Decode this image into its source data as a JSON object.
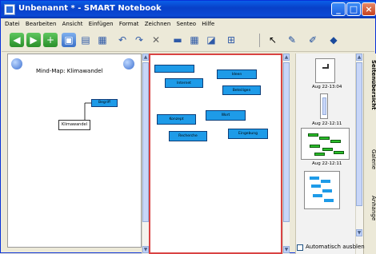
{
  "window": {
    "title": "Unbenannt * - SMART Notebook"
  },
  "menu": [
    "Datei",
    "Bearbeiten",
    "Ansicht",
    "Einfügen",
    "Format",
    "Zeichnen",
    "Senteo",
    "Hilfe"
  ],
  "left_panel": {
    "title": "Mind-Map: Klimawandel",
    "node_blue": "Begriff",
    "node_white": "Klimawandel"
  },
  "canvas_boxes": [
    "Internet",
    "Ideen",
    "Beteiligen",
    "Konzept",
    "Wort",
    "Recherche",
    "Eingebung"
  ],
  "sidebar": {
    "thumb1_label": "Aug 22-13:04",
    "thumb2_label": "Aug 22-12:11",
    "thumb3_label": "Aug 22-12:11",
    "autohide_label": "Automatisch ausblen"
  },
  "tabs": [
    "Seitenübersicht",
    "Galerie",
    "Anhänge"
  ],
  "colors": {
    "title_bar": "#0A5FE8",
    "node_blue": "#1E9BE8",
    "canvas_border": "#D94343"
  },
  "icons": [
    "window-app-icon",
    "minimize-icon",
    "maximize-icon",
    "close-icon",
    "back-arrow-icon",
    "forward-arrow-icon",
    "add-page-icon",
    "open-icon",
    "save-icon",
    "paste-icon",
    "undo-icon",
    "redo-icon",
    "delete-icon",
    "screen-shade-icon",
    "table-icon",
    "screen-capture-icon",
    "select-arrow-icon",
    "pen-icon",
    "highlighter-icon",
    "eraser-icon",
    "globe-icon"
  ]
}
